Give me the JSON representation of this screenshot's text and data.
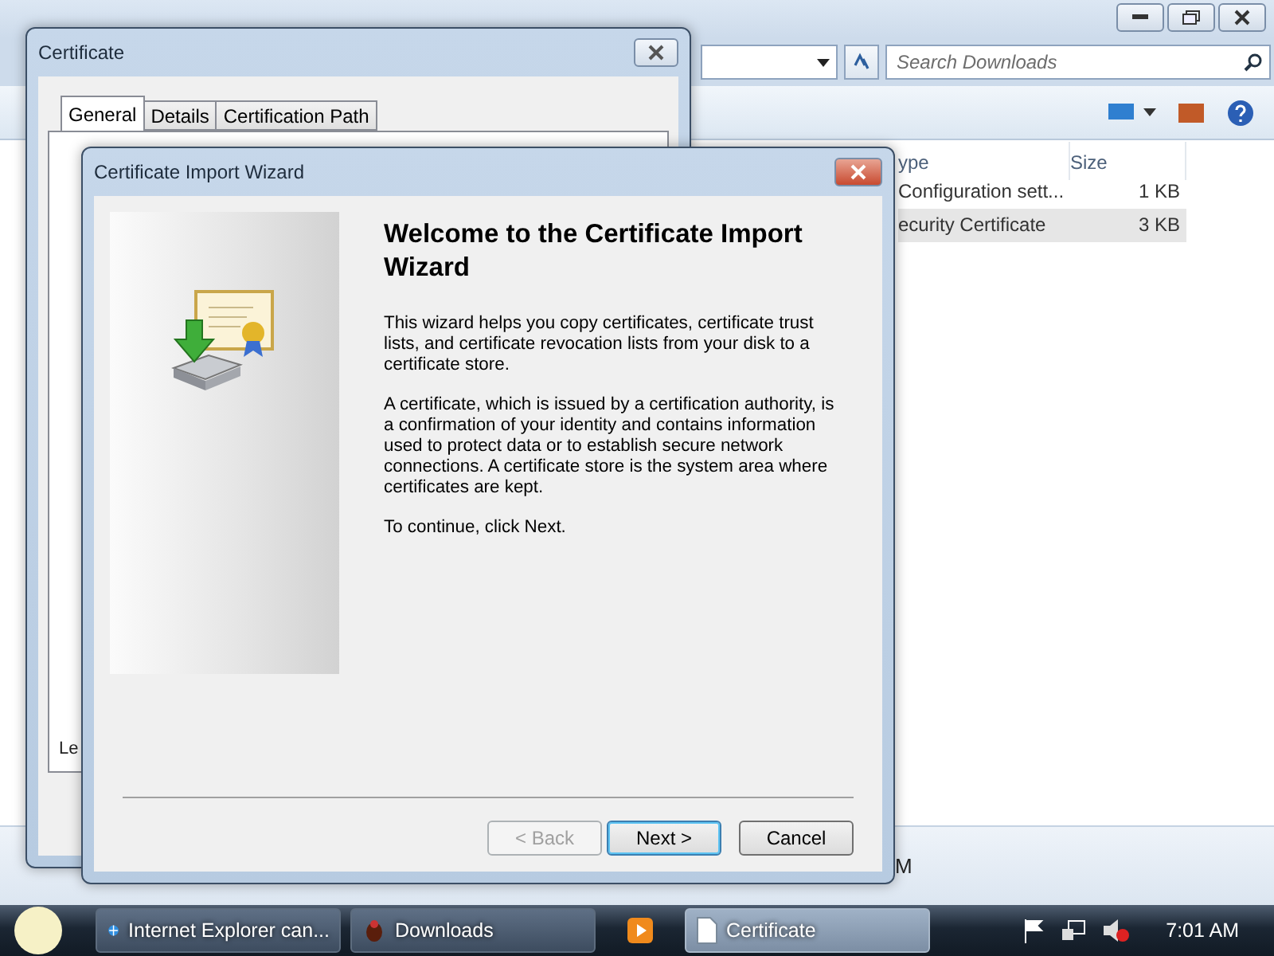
{
  "explorer": {
    "search_placeholder": "Search Downloads",
    "columns": [
      "ype",
      "Size"
    ],
    "files": [
      {
        "type": "Configuration sett...",
        "size": "1 KB",
        "selected": false
      },
      {
        "type": "ecurity Certificate",
        "size": "3 KB",
        "selected": true
      }
    ],
    "details_fragment": "M"
  },
  "certificate_window": {
    "title": "Certificate",
    "tabs": [
      {
        "label": "General",
        "selected": true
      },
      {
        "label": "Details",
        "selected": false
      },
      {
        "label": "Certification Path",
        "selected": false
      }
    ],
    "text_fragment": "Le"
  },
  "wizard": {
    "title": "Certificate Import Wizard",
    "heading": "Welcome to the Certificate Import Wizard",
    "paragraphs": [
      "This wizard helps you copy certificates, certificate trust lists, and certificate revocation lists from your disk to a certificate store.",
      "A certificate, which is issued by a certification authority, is a confirmation of your identity and contains information used to protect data or to establish secure network connections. A certificate store is the system area where certificates are kept.",
      "To continue, click Next."
    ],
    "buttons": [
      {
        "label": "< Back",
        "disabled": true,
        "default": false
      },
      {
        "label": "Next >",
        "disabled": false,
        "default": true
      },
      {
        "label": "Cancel",
        "disabled": false,
        "default": false
      }
    ]
  },
  "taskbar": {
    "tasks": [
      {
        "kind": "browser",
        "label": "Internet Explorer can...",
        "selected": false
      },
      {
        "kind": "folder",
        "label": "Downloads",
        "selected": false
      },
      {
        "kind": "media",
        "selected": false
      },
      {
        "kind": "document",
        "label": "Certificate",
        "selected": true
      }
    ],
    "clock": "7:01 AM"
  }
}
